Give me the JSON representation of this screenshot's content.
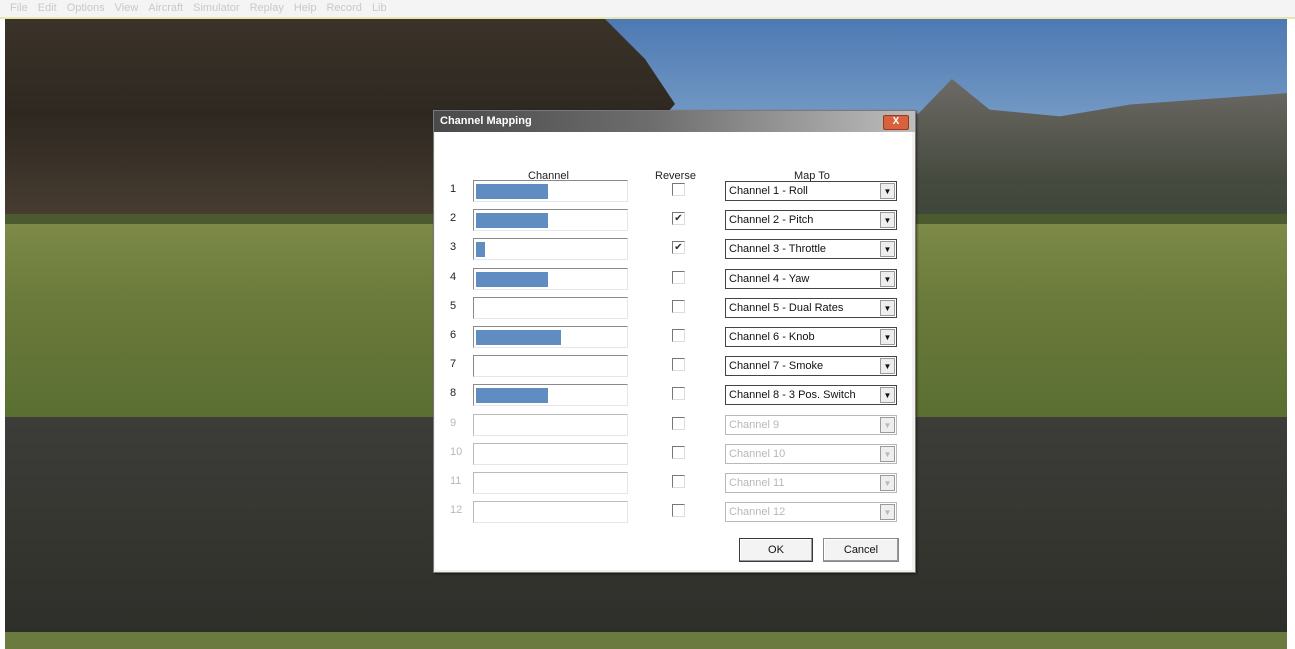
{
  "menu": [
    "File",
    "Edit",
    "Options",
    "View",
    "Aircraft",
    "Simulator",
    "Replay",
    "Help",
    "Record",
    "Lib"
  ],
  "dialog": {
    "title": "Channel Mapping",
    "close_label": "X",
    "headers": {
      "channel": "Channel",
      "reverse": "Reverse",
      "map_to": "Map To"
    },
    "rows": [
      {
        "num": "1",
        "level": 0.48,
        "reverse": false,
        "map": "Channel 1 - Roll",
        "enabled": true
      },
      {
        "num": "2",
        "level": 0.48,
        "reverse": true,
        "map": "Channel 2 - Pitch",
        "enabled": true
      },
      {
        "num": "3",
        "level": 0.06,
        "reverse": true,
        "map": "Channel 3 - Throttle",
        "enabled": true
      },
      {
        "num": "4",
        "level": 0.48,
        "reverse": false,
        "map": "Channel 4 - Yaw",
        "enabled": true
      },
      {
        "num": "5",
        "level": 0.0,
        "reverse": false,
        "map": "Channel 5 - Dual Rates",
        "enabled": true
      },
      {
        "num": "6",
        "level": 0.57,
        "reverse": false,
        "map": "Channel 6 - Knob",
        "enabled": true
      },
      {
        "num": "7",
        "level": 0.0,
        "reverse": false,
        "map": "Channel 7 - Smoke",
        "enabled": true
      },
      {
        "num": "8",
        "level": 0.48,
        "reverse": false,
        "map": "Channel 8 - 3 Pos. Switch",
        "enabled": true
      },
      {
        "num": "9",
        "level": 0.0,
        "reverse": false,
        "map": "Channel 9",
        "enabled": false
      },
      {
        "num": "10",
        "level": 0.0,
        "reverse": false,
        "map": "Channel 10",
        "enabled": false
      },
      {
        "num": "11",
        "level": 0.0,
        "reverse": false,
        "map": "Channel 11",
        "enabled": false
      },
      {
        "num": "12",
        "level": 0.0,
        "reverse": false,
        "map": "Channel 12",
        "enabled": false
      }
    ],
    "buttons": {
      "ok": "OK",
      "cancel": "Cancel"
    }
  },
  "colors": {
    "bar_fill": "#5f8cc1",
    "title_bar": "#4a4a4a",
    "close": "#d8623b"
  }
}
